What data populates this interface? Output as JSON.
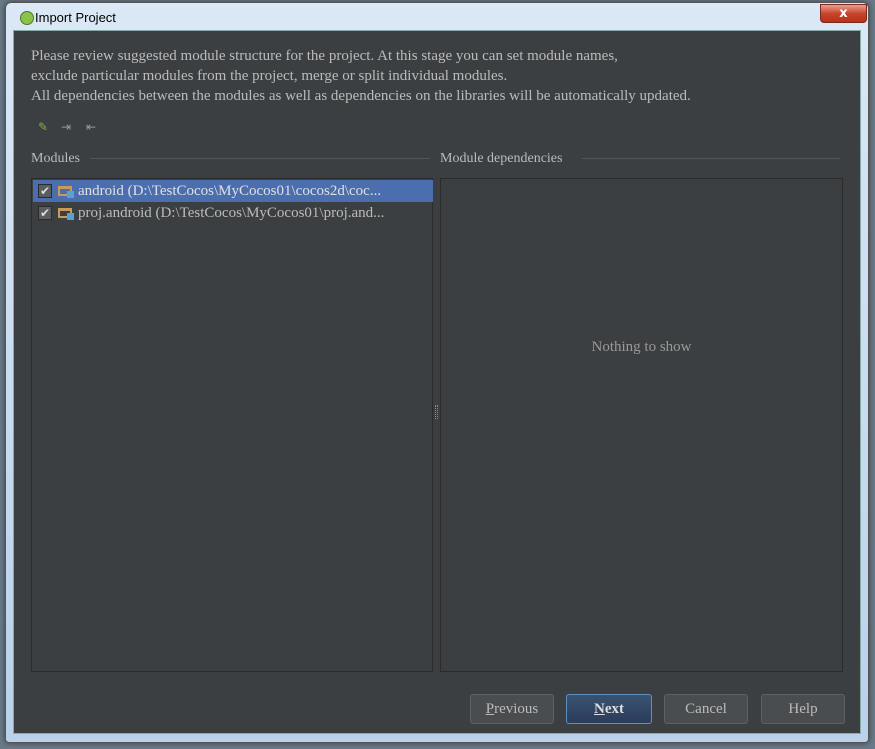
{
  "window": {
    "title": "Import Project",
    "close_label": "x"
  },
  "description": [
    "Please review suggested module structure for the project. At this stage you can set module names,",
    "exclude particular modules from the project, merge or split individual modules.",
    "All dependencies between the modules as well as dependencies on the libraries will be automatically updated."
  ],
  "toolbar": {
    "icons": [
      "edit-icon",
      "merge-icon",
      "split-icon"
    ]
  },
  "modules": {
    "header": "Modules",
    "items": [
      {
        "label": "android (D:\\TestCocos\\MyCocos01\\cocos2d\\coc...",
        "checked": true,
        "selected": true
      },
      {
        "label": "proj.android (D:\\TestCocos\\MyCocos01\\proj.and...",
        "checked": true,
        "selected": false
      }
    ]
  },
  "dependencies": {
    "header": "Module dependencies",
    "empty_text": "Nothing to show"
  },
  "buttons": {
    "previous_mn": "P",
    "previous_rest": "revious",
    "next_mn": "N",
    "next_rest": "ext",
    "cancel": "Cancel",
    "help": "Help"
  }
}
